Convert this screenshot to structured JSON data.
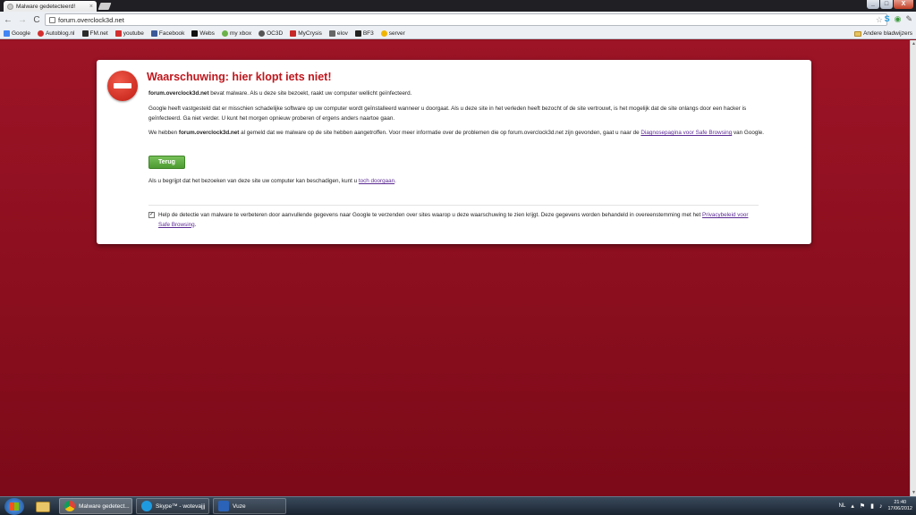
{
  "browser": {
    "tab_title": "Malware gedetecteerd!",
    "tab_close": "×",
    "url": "forum.overclock3d.net",
    "nav": {
      "back": "←",
      "forward": "→",
      "reload": "C"
    },
    "star": "☆",
    "window_controls": {
      "minimize": "_",
      "maximize": "□",
      "close": "X"
    }
  },
  "bookmarks": {
    "items": [
      {
        "label": "Google",
        "color": "#4285f4"
      },
      {
        "label": "Autoblog.nl",
        "color": "#d32f2f"
      },
      {
        "label": "FM.net",
        "color": "#2b2b2b"
      },
      {
        "label": "youtube",
        "color": "#d32f2f"
      },
      {
        "label": "Facebook",
        "color": "#3b5998"
      },
      {
        "label": "Webs",
        "color": "#111111"
      },
      {
        "label": "my xbox",
        "color": "#6bb24a"
      },
      {
        "label": "OC3D",
        "color": "#555555"
      },
      {
        "label": "MyCrysis",
        "color": "#c62828"
      },
      {
        "label": "elov",
        "color": "#666666"
      },
      {
        "label": "BF3",
        "color": "#222222"
      },
      {
        "label": "server",
        "color": "#f0b400"
      }
    ],
    "other": "Andere bladwijzers"
  },
  "warning": {
    "title": "Waarschuwing: hier klopt iets niet!",
    "site": "forum.overclock3d.net",
    "p1_rest": " bevat malware. Als u deze site bezoekt, raakt uw computer wellicht geïnfecteerd.",
    "p2": "Google heeft vastgesteld dat er misschien schadelijke software op uw computer wordt geïnstalleerd wanneer u doorgaat. Als u deze site in het verleden heeft bezocht of de site vertrouwt, is het mogelijk dat de site onlangs door een hacker is geïnfecteerd. Ga niet verder. U kunt het morgen opnieuw proberen of ergens anders naartoe gaan.",
    "p3_a": "We hebben ",
    "p3_site": "forum.overclock3d.net",
    "p3_b": " al gemeld dat we malware op de site hebben aangetroffen. Voor meer informatie over de problemen die op forum.overclock3d.net zijn gevonden, gaat u naar de ",
    "p3_link": "Diagnosepagina voor Safe Browsing",
    "p3_c": " van Google.",
    "back_button": "Terug",
    "p4_a": "Als u begrijpt dat het bezoeken van deze site uw computer kan beschadigen, kunt u ",
    "p4_link": "toch doorgaan",
    "p4_b": ".",
    "checkbox_checked": "✓",
    "checkbox_text": "Help de detectie van malware te verbeteren door aanvullende gegevens naar Google te verzenden over sites waarop u deze waarschuwing te zien krijgt. Deze gegevens worden behandeld in overeenstemming met het ",
    "checkbox_link": "Privacybeleid voor Safe Browsing",
    "checkbox_end": "."
  },
  "taskbar": {
    "tasks": [
      {
        "label": "Malware gedetect..."
      },
      {
        "label": "Skype™ - wotevajjj"
      },
      {
        "label": "Vuze"
      }
    ],
    "language": "NL",
    "time": "21:40",
    "date": "17/06/2012"
  }
}
